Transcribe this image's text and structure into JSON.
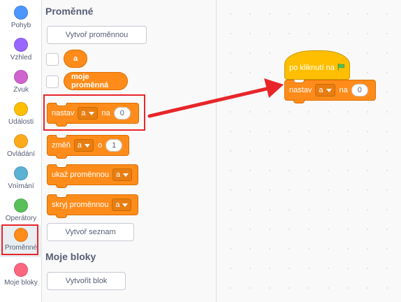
{
  "categories": [
    {
      "label": "Pohyb",
      "color": "#4c97ff"
    },
    {
      "label": "Vzhled",
      "color": "#9966ff"
    },
    {
      "label": "Zvuk",
      "color": "#cf63cf"
    },
    {
      "label": "Události",
      "color": "#ffbf00"
    },
    {
      "label": "Ovládání",
      "color": "#ffab19"
    },
    {
      "label": "Vnímání",
      "color": "#5cb1d6"
    },
    {
      "label": "Operátory",
      "color": "#59c059"
    },
    {
      "label": "Proměnné",
      "color": "#ff8c1a"
    },
    {
      "label": "Moje bloky",
      "color": "#ff6680"
    }
  ],
  "selected_category": "Proměnné",
  "highlight_color": "#e8262a",
  "palette": {
    "section_variables": "Proměnné",
    "create_variable_button": "Vytvoř proměnnou",
    "variables": [
      "a",
      "moje proměnná"
    ],
    "set_block": {
      "label": "nastav",
      "dropdown": "a",
      "to_label": "na",
      "value": "0"
    },
    "change_block": {
      "label": "změň",
      "dropdown": "a",
      "by_label": "o",
      "value": "1"
    },
    "show_block": {
      "label": "ukaž proměnnou",
      "dropdown": "a"
    },
    "hide_block": {
      "label": "skryj proměnnou",
      "dropdown": "a"
    },
    "create_list_button": "Vytvoř seznam",
    "section_my_blocks": "Moje bloky",
    "create_block_button": "Vytvořit blok"
  },
  "workspace": {
    "hat_label": "po kliknutí na",
    "hat_icon": "green-flag-icon",
    "set_block": {
      "label": "nastav",
      "dropdown": "a",
      "to_label": "na",
      "value": "0"
    }
  }
}
